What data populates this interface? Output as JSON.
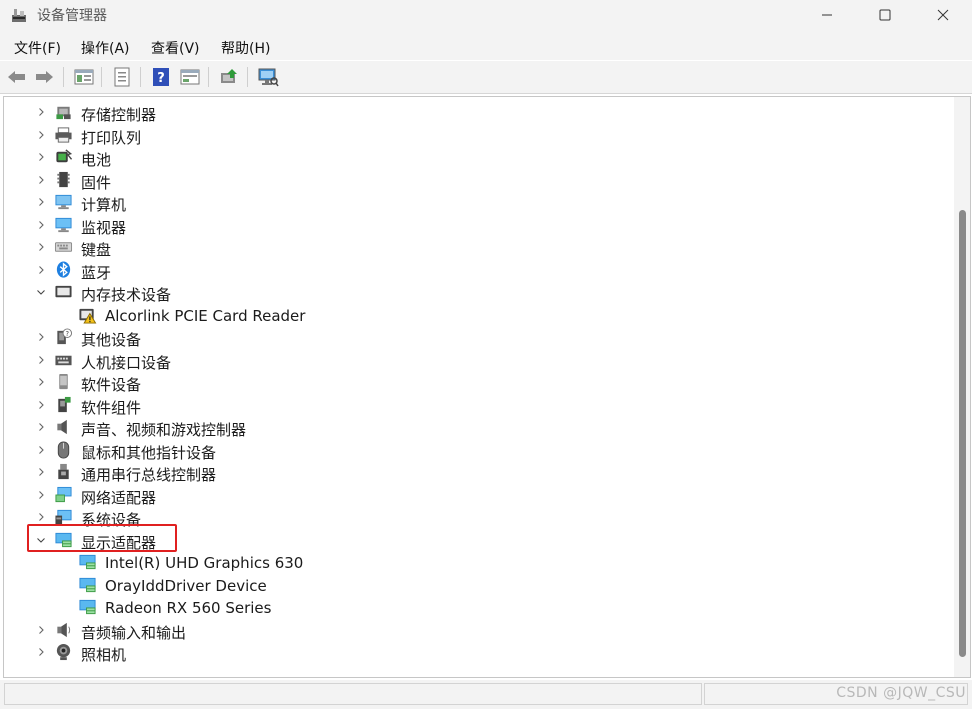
{
  "window": {
    "title": "设备管理器",
    "controls": {
      "minimize": "minimize",
      "maximize": "maximize",
      "close": "close"
    }
  },
  "menu": [
    {
      "label": "文件(F)"
    },
    {
      "label": "操作(A)"
    },
    {
      "label": "查看(V)"
    },
    {
      "label": "帮助(H)"
    }
  ],
  "toolbar": {
    "buttons": [
      "back-icon",
      "forward-icon",
      "show-hide-tree-icon",
      "properties-icon",
      "help-icon",
      "view-icon",
      "update-driver-icon",
      "scan-hardware-icon"
    ]
  },
  "tree": {
    "nodes": [
      {
        "label": "存储控制器",
        "icon": "storage-controller-icon",
        "state": "collapsed"
      },
      {
        "label": "打印队列",
        "icon": "printer-icon",
        "state": "collapsed"
      },
      {
        "label": "电池",
        "icon": "battery-icon",
        "state": "collapsed"
      },
      {
        "label": "固件",
        "icon": "firmware-icon",
        "state": "collapsed"
      },
      {
        "label": "计算机",
        "icon": "computer-icon",
        "state": "collapsed"
      },
      {
        "label": "监视器",
        "icon": "monitor-icon",
        "state": "collapsed"
      },
      {
        "label": "键盘",
        "icon": "keyboard-icon",
        "state": "collapsed"
      },
      {
        "label": "蓝牙",
        "icon": "bluetooth-icon",
        "state": "collapsed"
      },
      {
        "label": "内存技术设备",
        "icon": "memory-device-icon",
        "state": "expanded"
      },
      {
        "label": "Alcorlink PCIE Card Reader",
        "icon": "warning-device-icon",
        "state": "leaf"
      },
      {
        "label": "其他设备",
        "icon": "unknown-device-icon",
        "state": "collapsed"
      },
      {
        "label": "人机接口设备",
        "icon": "hid-icon",
        "state": "collapsed"
      },
      {
        "label": "软件设备",
        "icon": "software-device-icon",
        "state": "collapsed"
      },
      {
        "label": "软件组件",
        "icon": "software-component-icon",
        "state": "collapsed"
      },
      {
        "label": "声音、视频和游戏控制器",
        "icon": "speaker-icon",
        "state": "collapsed"
      },
      {
        "label": "鼠标和其他指针设备",
        "icon": "mouse-icon",
        "state": "collapsed"
      },
      {
        "label": "通用串行总线控制器",
        "icon": "usb-icon",
        "state": "collapsed"
      },
      {
        "label": "网络适配器",
        "icon": "network-adapter-icon",
        "state": "collapsed"
      },
      {
        "label": "系统设备",
        "icon": "system-device-icon",
        "state": "collapsed"
      },
      {
        "label": "显示适配器",
        "icon": "display-adapter-icon",
        "state": "expanded",
        "highlighted": true
      },
      {
        "label": "Intel(R) UHD Graphics 630",
        "icon": "display-adapter-icon",
        "state": "leaf"
      },
      {
        "label": "OrayIddDriver Device",
        "icon": "display-adapter-icon",
        "state": "leaf"
      },
      {
        "label": "Radeon RX 560 Series",
        "icon": "display-adapter-icon",
        "state": "leaf"
      },
      {
        "label": "音频输入和输出",
        "icon": "audio-io-icon",
        "state": "collapsed"
      },
      {
        "label": "照相机",
        "icon": "camera-icon",
        "state": "collapsed"
      }
    ]
  },
  "watermark": "CSDN @JQW_CSU",
  "colors": {
    "highlight": "#e02020",
    "accent": "#1f7fd6"
  }
}
